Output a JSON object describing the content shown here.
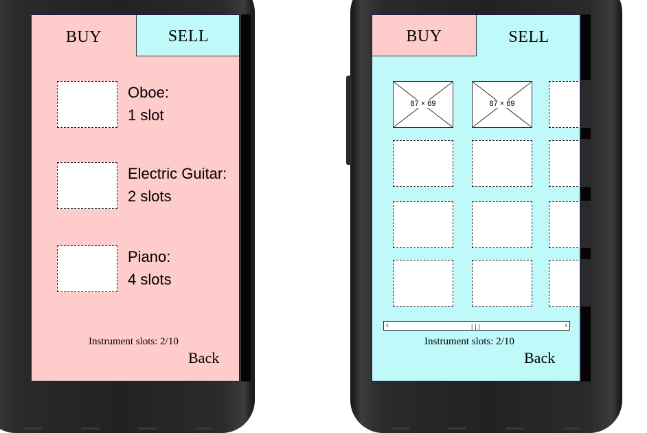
{
  "left_screen": {
    "tabs": [
      {
        "label": "BUY",
        "active": true
      },
      {
        "label": "SELL",
        "active": false
      }
    ],
    "items": [
      {
        "name": "Oboe:",
        "slots": "1 slot"
      },
      {
        "name": "Electric Guitar:",
        "slots": "2 slots"
      },
      {
        "name": "Piano:",
        "slots": "4 slots"
      }
    ],
    "status": "Instrument slots: 2/10",
    "back_label": "Back"
  },
  "right_screen": {
    "tabs": [
      {
        "label": "BUY",
        "active": false
      },
      {
        "label": "SELL",
        "active": true
      }
    ],
    "placeholder_label": "87 × 69",
    "status": "Instrument slots: 2/10",
    "back_label": "Back",
    "scrollbar_icons": [
      "chevron-left-icon",
      "grip-icon",
      "chevron-right-icon"
    ]
  },
  "colors": {
    "pink": "#ffcccc",
    "cyan": "#bff9f9",
    "screen_border": "#1a1a66",
    "phone_body": "#222222"
  }
}
